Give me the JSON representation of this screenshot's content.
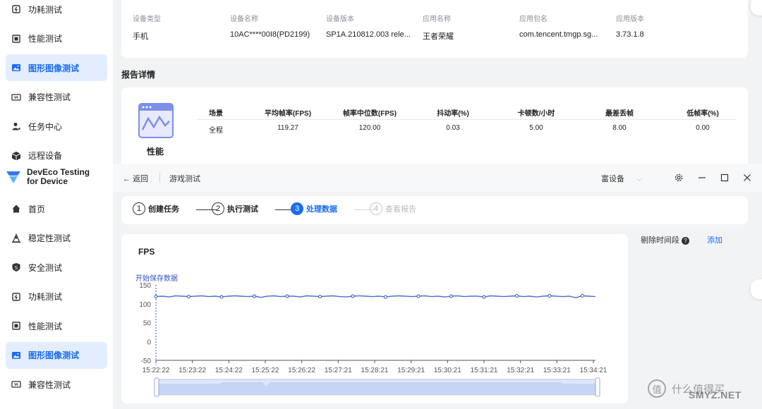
{
  "sidebar_top": {
    "items": [
      {
        "label": "功耗测试",
        "icon": "power-icon",
        "active": false
      },
      {
        "label": "性能测试",
        "icon": "chip-icon",
        "active": false
      },
      {
        "label": "图形图像测试",
        "icon": "image-icon",
        "active": true
      },
      {
        "label": "兼容性测试",
        "icon": "compat-icon",
        "active": false
      },
      {
        "label": "任务中心",
        "icon": "user-task-icon",
        "active": false
      },
      {
        "label": "远程设备",
        "icon": "cube-icon",
        "active": false
      }
    ]
  },
  "brand": {
    "line1": "DevEco Testing",
    "line2": "for Device"
  },
  "sidebar_bottom": {
    "items": [
      {
        "label": "首页",
        "icon": "home-icon",
        "active": false
      },
      {
        "label": "稳定性测试",
        "icon": "stability-icon",
        "active": false
      },
      {
        "label": "安全测试",
        "icon": "shield-icon",
        "active": false
      },
      {
        "label": "功耗测试",
        "icon": "power-icon",
        "active": false
      },
      {
        "label": "性能测试",
        "icon": "chip-icon",
        "active": false
      },
      {
        "label": "图形图像测试",
        "icon": "image-icon",
        "active": true
      },
      {
        "label": "兼容性测试",
        "icon": "compat-icon",
        "active": false
      }
    ]
  },
  "device_info": {
    "columns": [
      {
        "label": "设备类型",
        "value": "手机"
      },
      {
        "label": "设备名称",
        "value": "10AC****00I8(PD2199)"
      },
      {
        "label": "设备版本",
        "value": "SP1A.210812.003 rele..."
      },
      {
        "label": "应用名称",
        "value": "王者荣耀"
      },
      {
        "label": "应用包名",
        "value": "com.tencent.tmgp.sg..."
      },
      {
        "label": "应用版本",
        "value": "3.73.1.8"
      }
    ]
  },
  "report": {
    "section_title": "报告详情",
    "perf_label": "性能",
    "headers": [
      "场景",
      "平均帧率(FPS)",
      "帧率中位数(FPS)",
      "抖动率(%)",
      "卡顿数/小时",
      "最差丢帧",
      "低帧率(%)"
    ],
    "row": [
      "全程",
      "119.27",
      "120.00",
      "0.03",
      "5.00",
      "8.00",
      "0.00"
    ]
  },
  "titlebar": {
    "back": "返回",
    "title": "游戏测试",
    "device_select": "富设备"
  },
  "stepper": {
    "steps": [
      {
        "num": "1",
        "label": "创建任务",
        "state": "done"
      },
      {
        "num": "2",
        "label": "执行测试",
        "state": "done"
      },
      {
        "num": "3",
        "label": "处理数据",
        "state": "active"
      },
      {
        "num": "4",
        "label": "查看报告",
        "state": "pending"
      }
    ]
  },
  "side_panel": {
    "label": "剔除时间段",
    "add": "添加"
  },
  "watermark": {
    "main": "什么值得买",
    "sub": "SMYZ.NET"
  },
  "colors": {
    "accent": "#1a6cf0",
    "line": "#4a6fd8",
    "marker": "#2f52c8"
  },
  "chart_data": {
    "type": "line",
    "title": "FPS",
    "annotation": "开始保存数据",
    "ylim": [
      -50,
      150
    ],
    "yticks": [
      "150",
      "100",
      "50",
      "0",
      "-50"
    ],
    "xticks": [
      "15:22:22",
      "15:23:22",
      "15:24:22",
      "15:25:22",
      "15:26:22",
      "15:27:21",
      "15:28:21",
      "15:29:21",
      "15:30:21",
      "15:31:21",
      "15:32:21",
      "15:33:21",
      "15:34:21"
    ],
    "grid": false,
    "series": [
      {
        "values": [
          119,
          120,
          118,
          121,
          120,
          119,
          120,
          121,
          119,
          120,
          118,
          120,
          121,
          120,
          119,
          120,
          117,
          120,
          121,
          119,
          120,
          120,
          118,
          121,
          120,
          119,
          120,
          121,
          119,
          118,
          120,
          121,
          120,
          119,
          120,
          118,
          120,
          121,
          120,
          119,
          120,
          121,
          119,
          120,
          118,
          120,
          121,
          119,
          120,
          120,
          118,
          121,
          120,
          119,
          120,
          121,
          119,
          120,
          118,
          120,
          121,
          120,
          119,
          120,
          116,
          121,
          120,
          119
        ]
      }
    ]
  }
}
